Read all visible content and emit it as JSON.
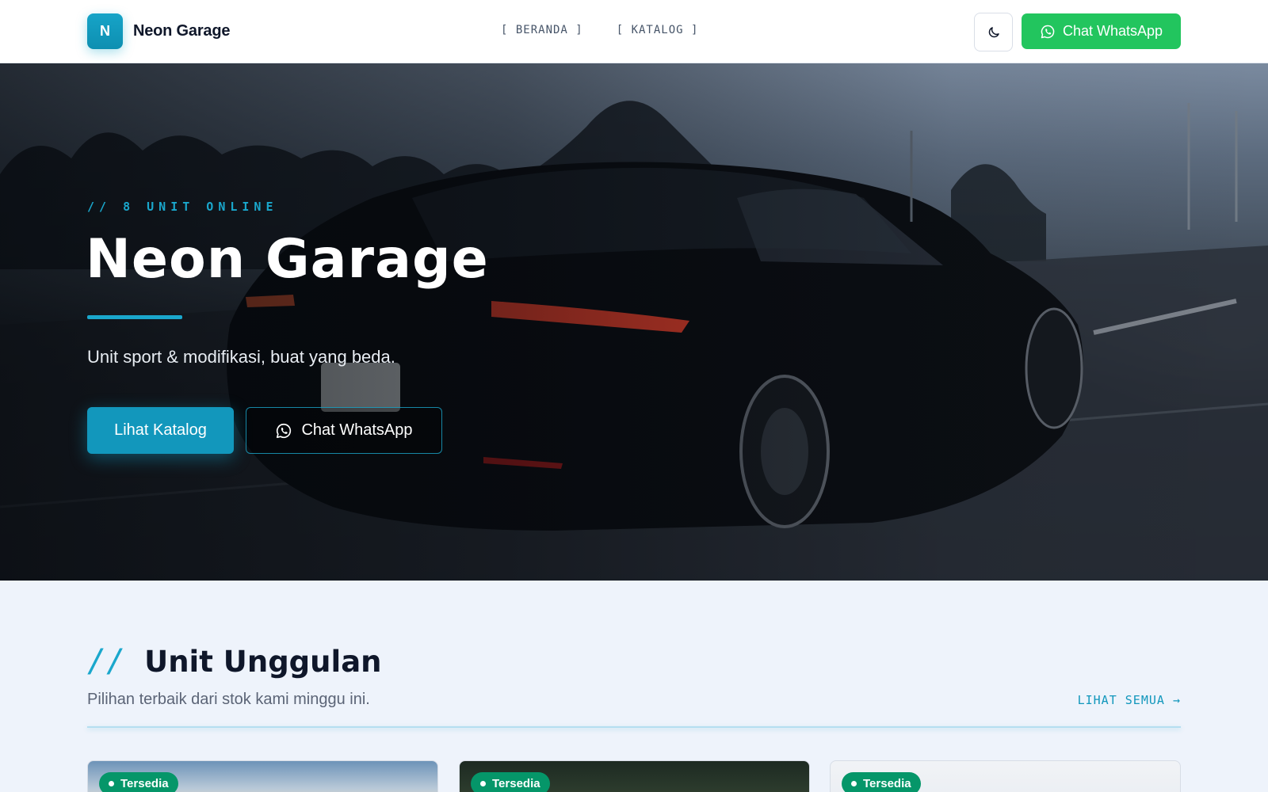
{
  "header": {
    "logo_letter": "N",
    "brand": "Neon Garage",
    "nav": [
      "[ BERANDA ]",
      "[ KATALOG ]"
    ],
    "whatsapp_label": "Chat WhatsApp"
  },
  "hero": {
    "tag": "// 8 UNIT ONLINE",
    "title": "Neon Garage",
    "subtitle": "Unit sport & modifikasi, buat yang beda.",
    "primary_button": "Lihat Katalog",
    "secondary_button": "Chat WhatsApp"
  },
  "featured": {
    "slashes": "//",
    "title": "Unit Unggulan",
    "subtitle": "Pilihan terbaik dari stok kami minggu ini.",
    "see_all": "LIHAT SEMUA →",
    "cards": [
      {
        "status": "Tersedia"
      },
      {
        "status": "Tersedia"
      },
      {
        "status": "Tersedia"
      }
    ]
  },
  "colors": {
    "accent": "#1aa7cc",
    "whatsapp": "#22c55e",
    "badge": "#059669"
  },
  "icons": [
    "moon-icon",
    "whatsapp-icon"
  ]
}
